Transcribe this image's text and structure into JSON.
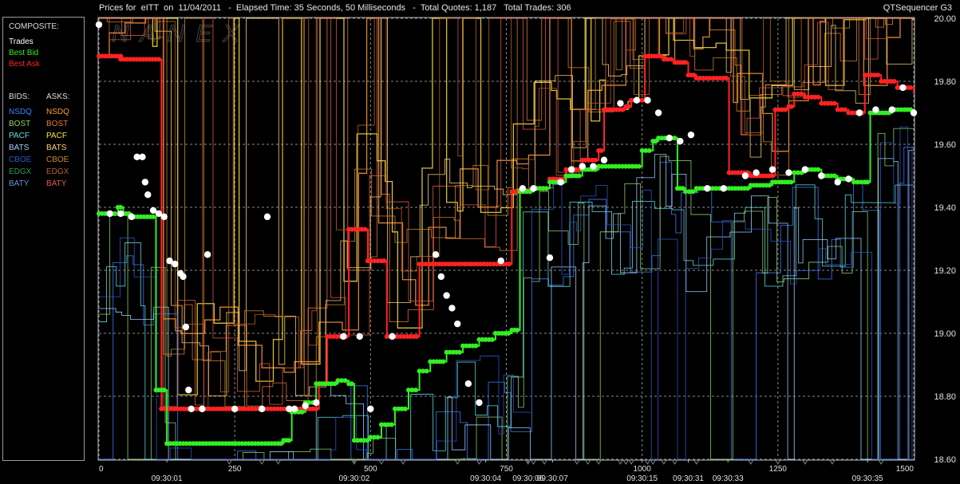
{
  "header": {
    "prices_for": "Prices for",
    "symbol": "eITT",
    "on": "on",
    "date": "11/04/2011",
    "elapsed": "Elapsed Time: 35 Seconds, 50 Milliseconds",
    "total_quotes": "Total Quotes: 1,187",
    "total_trades": "Total Trades: 306",
    "app_name": "QTSequencer G3"
  },
  "watermark": "NANEX",
  "legend": {
    "composite_label": "COMPOSITE:",
    "trades": "Trades",
    "best_bid": "Best Bid",
    "best_ask": "Best Ask",
    "bids_label": "BIDS:",
    "asks_label": "ASKS:",
    "exchanges": [
      {
        "bid": "NSDQ",
        "ask": "NSDQ",
        "bid_color": "#3f7fff",
        "ask_color": "#ff9a3c"
      },
      {
        "bid": "BOST",
        "ask": "BOST",
        "bid_color": "#8fd36a",
        "ask_color": "#e07a3a"
      },
      {
        "bid": "PACF",
        "ask": "PACF",
        "bid_color": "#5fe0e0",
        "ask_color": "#ffe040"
      },
      {
        "bid": "BATS",
        "ask": "BATS",
        "bid_color": "#9fd0ff",
        "ask_color": "#ffd27a"
      },
      {
        "bid": "CBOE",
        "ask": "CBOE",
        "bid_color": "#2f57c8",
        "ask_color": "#d08a2a"
      },
      {
        "bid": "EDGX",
        "ask": "EDGX",
        "bid_color": "#2f9a5a",
        "ask_color": "#c0602a"
      },
      {
        "bid": "BATY",
        "ask": "BATY",
        "bid_color": "#6f8fe0",
        "ask_color": "#e05a4a"
      }
    ],
    "colors": {
      "trades": "#ffffff",
      "best_bid": "#33ee22",
      "best_ask": "#ff2222",
      "text": "#dcdcdc"
    }
  },
  "chart_data": {
    "type": "line",
    "ylim": [
      18.6,
      20.0
    ],
    "xlim": [
      0,
      1500
    ],
    "y_ticks": [
      "18.60",
      "18.80",
      "19.00",
      "19.20",
      "19.40",
      "19.60",
      "19.80",
      "20.00"
    ],
    "x_index_ticks": [
      0,
      250,
      500,
      750,
      1000,
      1250,
      1500
    ],
    "time_ticks": [
      {
        "x": 125,
        "label": "09:30:01"
      },
      {
        "x": 470,
        "label": "09:30:02"
      },
      {
        "x": 712,
        "label": "09:30:04"
      },
      {
        "x": 790,
        "label": "09:30:06"
      },
      {
        "x": 835,
        "label": "09:30:07"
      },
      {
        "x": 1000,
        "label": "09:30:15"
      },
      {
        "x": 1085,
        "label": "09:30:31"
      },
      {
        "x": 1158,
        "label": "09:30:33"
      },
      {
        "x": 1415,
        "label": "09:30:35"
      }
    ],
    "grid": true,
    "series": [
      {
        "name": "Best Ask",
        "color": "#ff2222",
        "points": [
          [
            0,
            19.88
          ],
          [
            40,
            19.88
          ],
          [
            40,
            19.87
          ],
          [
            70,
            19.87
          ],
          [
            110,
            19.87
          ],
          [
            115,
            18.76
          ],
          [
            400,
            18.76
          ],
          [
            405,
            18.84
          ],
          [
            420,
            18.99
          ],
          [
            450,
            18.99
          ],
          [
            460,
            19.33
          ],
          [
            490,
            19.33
          ],
          [
            495,
            19.23
          ],
          [
            520,
            19.23
          ],
          [
            530,
            18.99
          ],
          [
            580,
            18.99
          ],
          [
            590,
            19.22
          ],
          [
            750,
            19.22
          ],
          [
            760,
            19.45
          ],
          [
            800,
            19.46
          ],
          [
            830,
            19.49
          ],
          [
            860,
            19.52
          ],
          [
            890,
            19.55
          ],
          [
            920,
            19.58
          ],
          [
            930,
            19.71
          ],
          [
            970,
            19.72
          ],
          [
            980,
            19.74
          ],
          [
            1000,
            19.74
          ],
          [
            1005,
            19.88
          ],
          [
            1040,
            19.87
          ],
          [
            1060,
            19.86
          ],
          [
            1075,
            19.86
          ],
          [
            1085,
            19.82
          ],
          [
            1100,
            19.81
          ],
          [
            1150,
            19.81
          ],
          [
            1160,
            19.51
          ],
          [
            1200,
            19.5
          ],
          [
            1240,
            19.5
          ],
          [
            1245,
            19.71
          ],
          [
            1270,
            19.72
          ],
          [
            1280,
            19.76
          ],
          [
            1300,
            19.75
          ],
          [
            1330,
            19.73
          ],
          [
            1360,
            19.71
          ],
          [
            1380,
            19.7
          ],
          [
            1400,
            19.7
          ],
          [
            1410,
            19.82
          ],
          [
            1440,
            19.8
          ],
          [
            1470,
            19.78
          ],
          [
            1500,
            19.76
          ]
        ]
      },
      {
        "name": "Best Bid",
        "color": "#33ee22",
        "points": [
          [
            0,
            19.38
          ],
          [
            35,
            19.4
          ],
          [
            45,
            19.38
          ],
          [
            60,
            19.37
          ],
          [
            100,
            19.37
          ],
          [
            105,
            18.82
          ],
          [
            120,
            18.82
          ],
          [
            125,
            18.65
          ],
          [
            330,
            18.65
          ],
          [
            340,
            18.66
          ],
          [
            355,
            18.75
          ],
          [
            380,
            18.78
          ],
          [
            400,
            18.84
          ],
          [
            440,
            18.85
          ],
          [
            460,
            18.84
          ],
          [
            470,
            18.66
          ],
          [
            500,
            18.67
          ],
          [
            520,
            18.71
          ],
          [
            545,
            18.76
          ],
          [
            570,
            18.82
          ],
          [
            590,
            18.88
          ],
          [
            610,
            18.91
          ],
          [
            640,
            18.94
          ],
          [
            670,
            18.96
          ],
          [
            700,
            18.98
          ],
          [
            730,
            19.0
          ],
          [
            760,
            19.01
          ],
          [
            775,
            19.45
          ],
          [
            800,
            19.46
          ],
          [
            830,
            19.48
          ],
          [
            860,
            19.5
          ],
          [
            890,
            19.52
          ],
          [
            920,
            19.53
          ],
          [
            970,
            19.53
          ],
          [
            1000,
            19.58
          ],
          [
            1020,
            19.61
          ],
          [
            1030,
            19.62
          ],
          [
            1060,
            19.62
          ],
          [
            1065,
            19.46
          ],
          [
            1080,
            19.45
          ],
          [
            1100,
            19.46
          ],
          [
            1130,
            19.46
          ],
          [
            1160,
            19.46
          ],
          [
            1200,
            19.47
          ],
          [
            1240,
            19.48
          ],
          [
            1280,
            19.51
          ],
          [
            1300,
            19.52
          ],
          [
            1330,
            19.5
          ],
          [
            1360,
            19.49
          ],
          [
            1390,
            19.48
          ],
          [
            1410,
            19.48
          ],
          [
            1420,
            19.7
          ],
          [
            1460,
            19.71
          ],
          [
            1500,
            19.71
          ]
        ]
      }
    ],
    "trades": [
      [
        0,
        19.98
      ],
      [
        20,
        19.38
      ],
      [
        40,
        19.38
      ],
      [
        60,
        19.37
      ],
      [
        70,
        19.56
      ],
      [
        80,
        19.56
      ],
      [
        85,
        19.48
      ],
      [
        90,
        19.44
      ],
      [
        100,
        19.39
      ],
      [
        110,
        19.38
      ],
      [
        120,
        19.37
      ],
      [
        130,
        19.23
      ],
      [
        140,
        19.22
      ],
      [
        150,
        19.19
      ],
      [
        155,
        19.18
      ],
      [
        160,
        19.02
      ],
      [
        165,
        18.82
      ],
      [
        170,
        18.76
      ],
      [
        190,
        18.76
      ],
      [
        200,
        19.25
      ],
      [
        250,
        18.76
      ],
      [
        300,
        18.76
      ],
      [
        310,
        19.37
      ],
      [
        350,
        18.76
      ],
      [
        360,
        18.76
      ],
      [
        380,
        18.77
      ],
      [
        400,
        18.78
      ],
      [
        450,
        18.99
      ],
      [
        480,
        18.99
      ],
      [
        500,
        18.76
      ],
      [
        540,
        18.99
      ],
      [
        620,
        19.25
      ],
      [
        630,
        19.18
      ],
      [
        640,
        19.12
      ],
      [
        650,
        19.08
      ],
      [
        660,
        19.03
      ],
      [
        680,
        18.84
      ],
      [
        700,
        18.78
      ],
      [
        740,
        19.23
      ],
      [
        780,
        19.46
      ],
      [
        800,
        19.46
      ],
      [
        830,
        19.24
      ],
      [
        850,
        19.48
      ],
      [
        870,
        19.52
      ],
      [
        890,
        19.53
      ],
      [
        910,
        19.53
      ],
      [
        930,
        19.55
      ],
      [
        960,
        19.73
      ],
      [
        990,
        19.74
      ],
      [
        1010,
        19.74
      ],
      [
        1030,
        19.7
      ],
      [
        1050,
        19.62
      ],
      [
        1070,
        19.61
      ],
      [
        1090,
        19.63
      ],
      [
        1120,
        19.46
      ],
      [
        1150,
        19.46
      ],
      [
        1190,
        19.5
      ],
      [
        1210,
        19.51
      ],
      [
        1240,
        19.52
      ],
      [
        1270,
        19.51
      ],
      [
        1300,
        19.52
      ],
      [
        1330,
        19.5
      ],
      [
        1360,
        19.48
      ],
      [
        1380,
        19.49
      ],
      [
        1400,
        19.7
      ],
      [
        1430,
        19.71
      ],
      [
        1460,
        19.71
      ],
      [
        1480,
        19.78
      ],
      [
        1500,
        19.7
      ]
    ]
  }
}
